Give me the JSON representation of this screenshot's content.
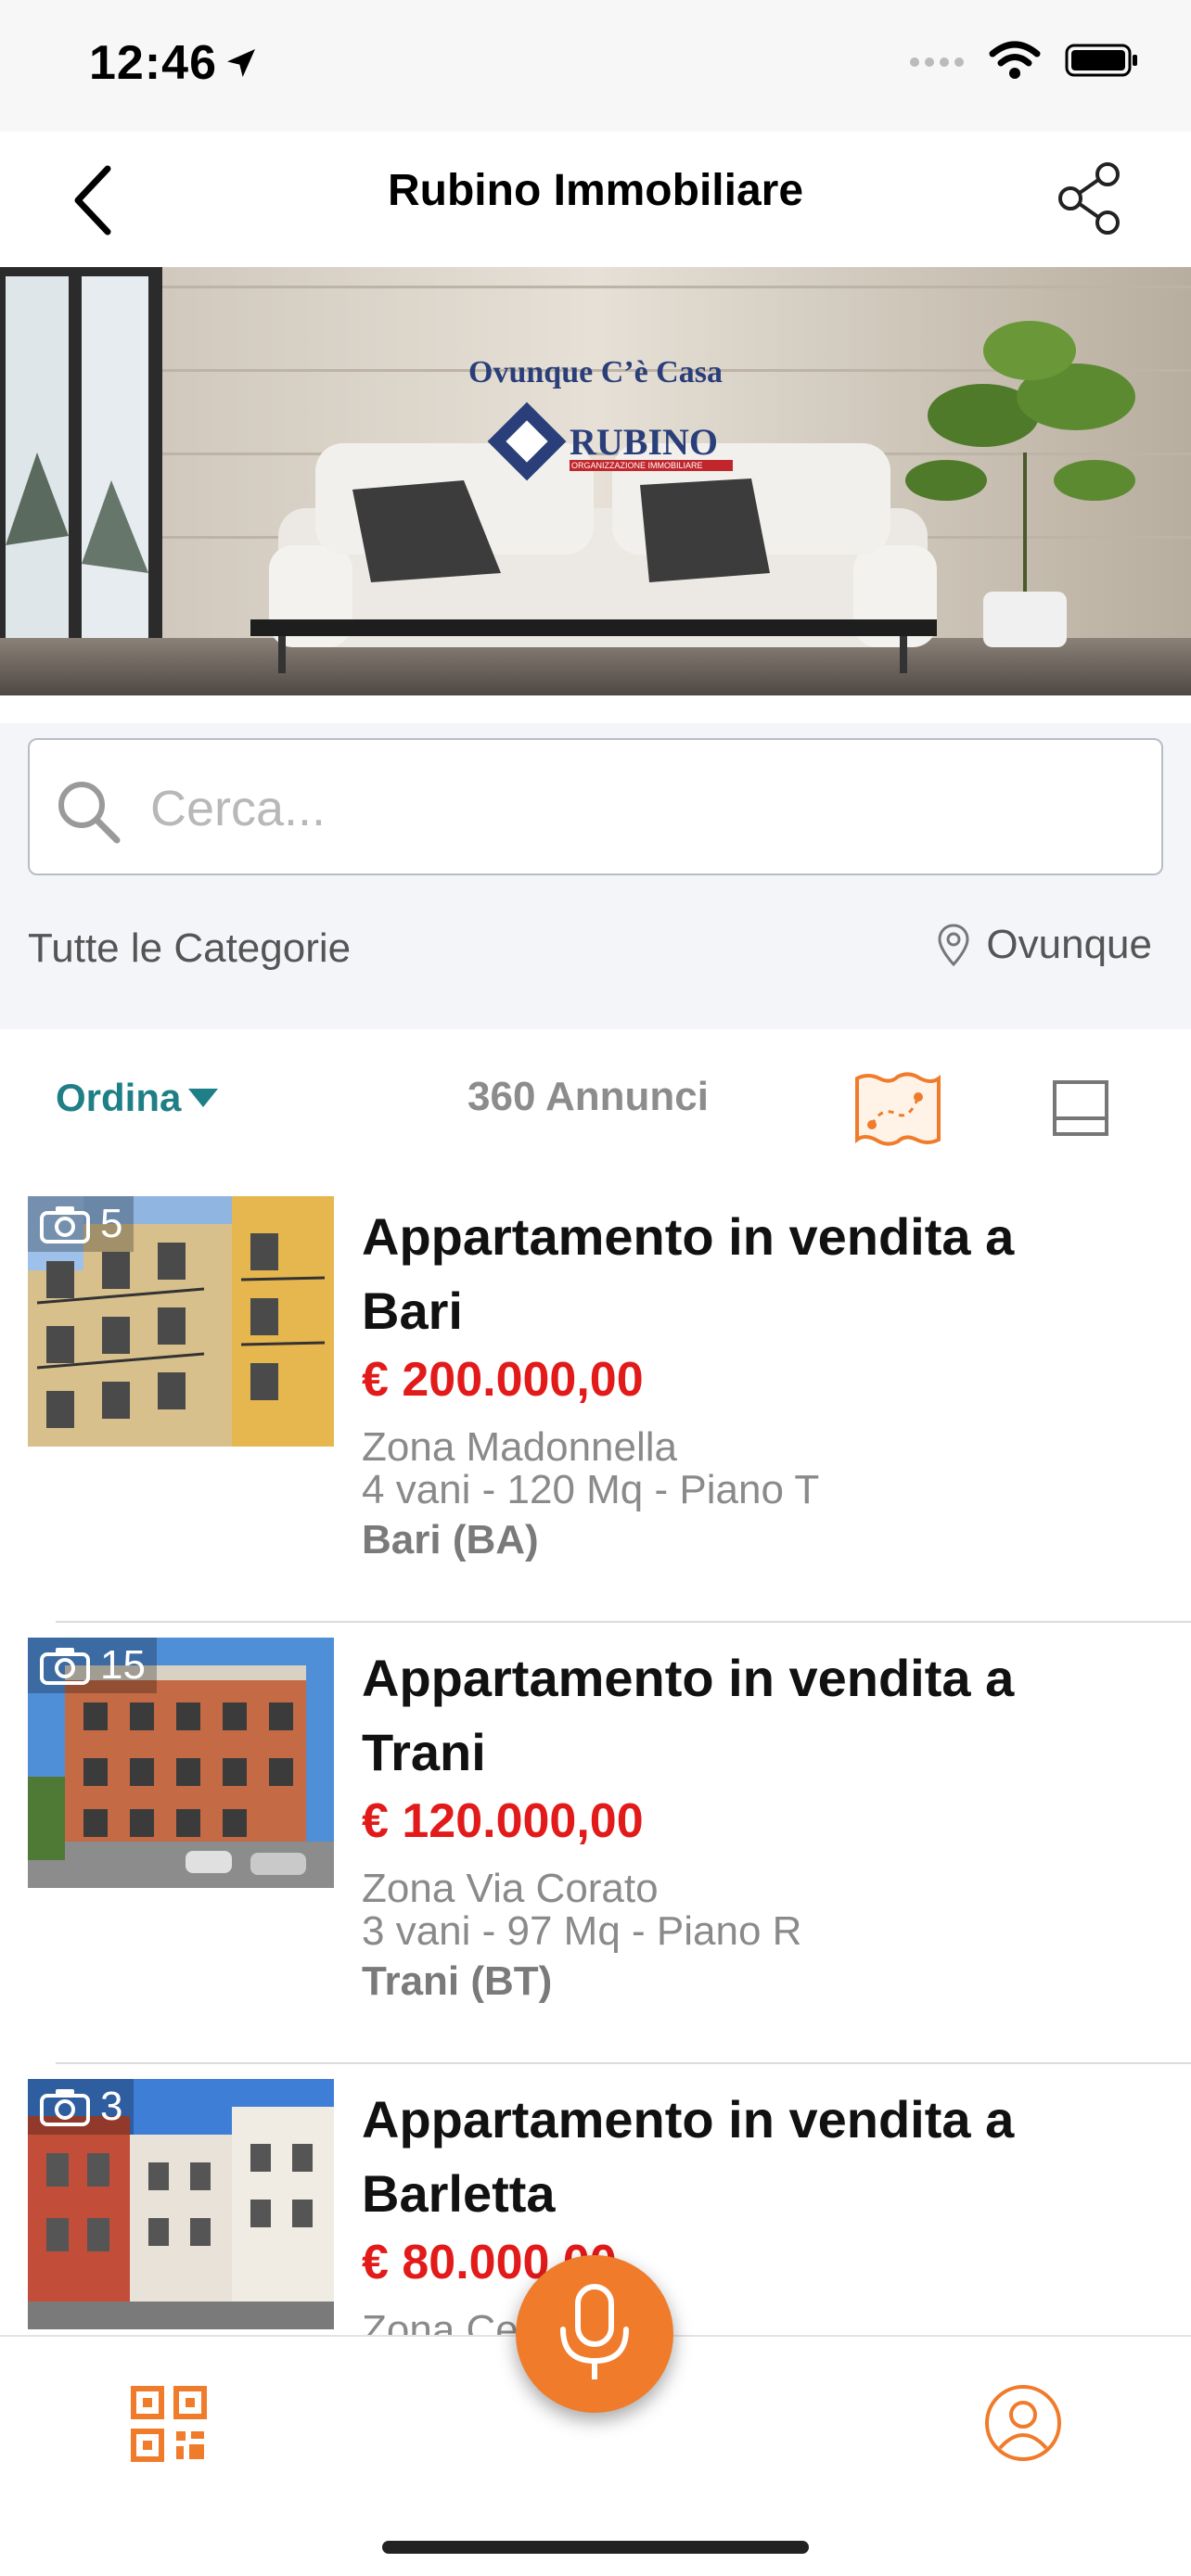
{
  "status_bar": {
    "time": "12:46"
  },
  "nav": {
    "title": "Rubino Immobiliare"
  },
  "banner": {
    "tagline": "Ovunque C’è Casa",
    "brand": "RUBINO",
    "brand_sub": "ORGANIZZAZIONE IMMOBILIARE"
  },
  "search": {
    "placeholder": "Cerca..."
  },
  "filters": {
    "category": "Tutte le Categorie",
    "location": "Ovunque"
  },
  "toolbar": {
    "sort_label": "Ordina",
    "count_label": "360 Annunci"
  },
  "listings": [
    {
      "photos": "5",
      "title": "Appartamento in vendita a Bari",
      "price": "€ 200.000,00",
      "zone": "Zona Madonnella",
      "specs": "4 vani - 120 Mq - Piano T",
      "city": "Bari (BA)"
    },
    {
      "photos": "15",
      "title": "Appartamento in vendita a Trani",
      "price": "€ 120.000,00",
      "zone": "Zona Via Corato",
      "specs": "3 vani - 97 Mq - Piano R",
      "city": "Trani (BT)"
    },
    {
      "photos": "3",
      "title": "Appartamento in vendita a Barletta",
      "price": "€ 80.000,00",
      "zone": "Zona Ce",
      "specs": "",
      "city": ""
    }
  ],
  "colors": {
    "accent": "#f07b2b",
    "teal": "#1f7f86",
    "price": "#e21a1a"
  },
  "icons": {
    "back": "chevron-left-icon",
    "share": "share-icon",
    "search": "search-icon",
    "location": "location-pin-icon",
    "map": "map-icon",
    "view": "view-toggle-icon",
    "camera": "camera-icon",
    "qr": "qr-code-icon",
    "profile": "profile-icon",
    "mic": "microphone-icon"
  }
}
